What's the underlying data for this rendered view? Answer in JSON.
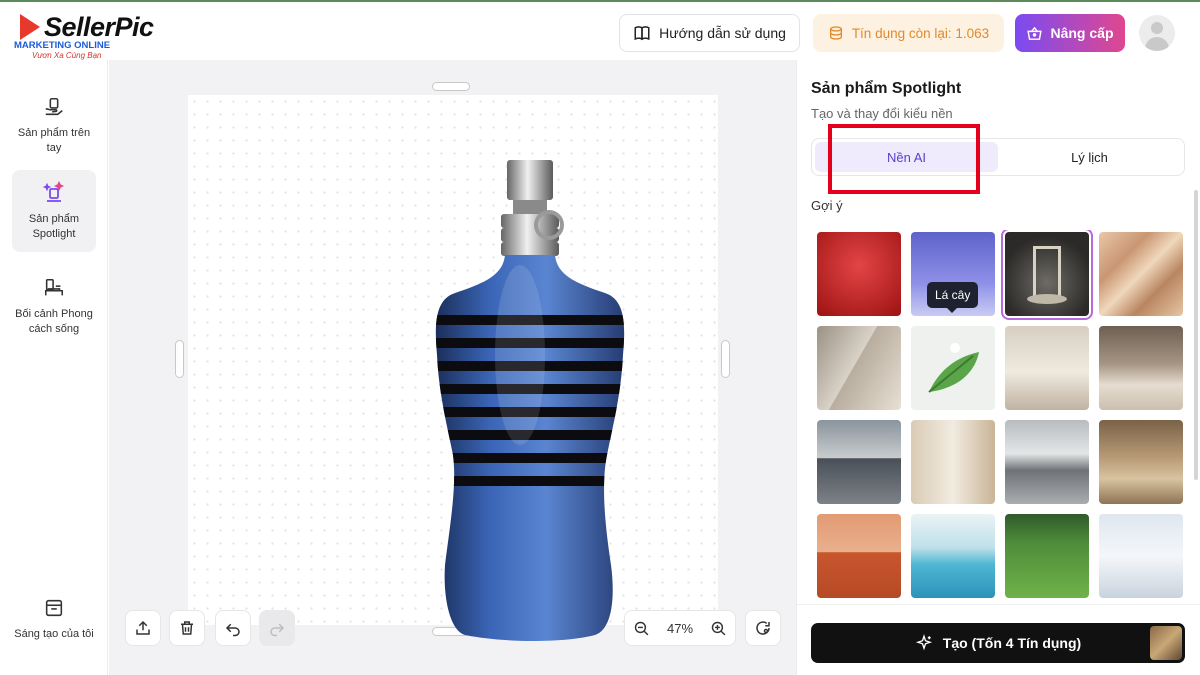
{
  "header": {
    "logo_brand": "SellerPic",
    "logo_subtitle": "MARKETING ONLINE",
    "logo_tagline": "Vươn Xa Cùng Bạn",
    "guide_label": "Hướng dẫn sử dụng",
    "credit_label": "Tín dụng còn lại: 1.063",
    "upgrade_label": "Nâng cấp",
    "brand_color": "#7a4bf2",
    "credit_color": "#e08a2c"
  },
  "sidebar": {
    "items": [
      {
        "label": "Sản phẩm trên tay",
        "icon": "hand-product-icon",
        "active": false
      },
      {
        "label": "Sản phẩm Spotlight",
        "icon": "spotlight-icon",
        "active": true
      },
      {
        "label": "Bối cảnh Phong cách sống",
        "icon": "lifestyle-scene-icon",
        "active": false
      }
    ],
    "bottom_item": {
      "label": "Sáng tạo của tôi",
      "icon": "my-creations-icon"
    }
  },
  "canvas": {
    "zoom": "47%",
    "tools": [
      "upload-icon",
      "trash-icon",
      "undo-icon",
      "redo-icon"
    ]
  },
  "panel": {
    "title": "Sản phẩm Spotlight",
    "subtitle": "Tạo và thay đổi kiểu nền",
    "tabs": [
      {
        "label": "Nền AI",
        "active": true
      },
      {
        "label": "Lý lịch",
        "active": false
      }
    ],
    "suggest_label": "Gợi ý",
    "tooltip": "Lá cây",
    "thumbnails": [
      {
        "name": "red-backdrop",
        "selected": false
      },
      {
        "name": "blue-backdrop",
        "selected": false
      },
      {
        "name": "spotlight-pedestal",
        "selected": true
      },
      {
        "name": "silk-fabric",
        "selected": false
      },
      {
        "name": "shadow-wall",
        "selected": false
      },
      {
        "name": "leaf",
        "selected": false
      },
      {
        "name": "vanity-table",
        "selected": false
      },
      {
        "name": "bedroom",
        "selected": false
      },
      {
        "name": "office-desk",
        "selected": false
      },
      {
        "name": "shelf-decor",
        "selected": false
      },
      {
        "name": "modern-kitchen",
        "selected": false
      },
      {
        "name": "living-room-sofa",
        "selected": false
      },
      {
        "name": "tennis-court",
        "selected": false
      },
      {
        "name": "swimming-pool",
        "selected": false
      },
      {
        "name": "grass-field",
        "selected": false
      },
      {
        "name": "snow",
        "selected": false
      }
    ],
    "generate_label": "Tạo (Tốn 4 Tín dụng)"
  }
}
